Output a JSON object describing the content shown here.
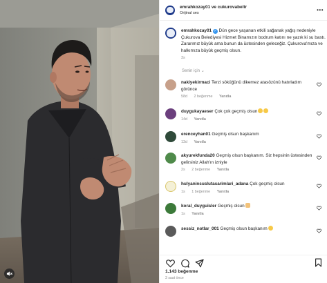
{
  "header": {
    "title": "emrahkozay01 ve cukurovabeltr",
    "subtitle": "Orijinal ses",
    "more_icon": "more-horizontal-icon"
  },
  "caption": {
    "username": "emrahkozay01",
    "text": "Dün gece yaşanan etkili sağanak yağış nedeniyle Çukurova Belediyesi Hizmet Binamızın bodrum katını ne yazık ki su bastı. Zararımız büyük ama bunun da üstesinden geleceğiz. Çukurova'mıza ve halkımıza büyük geçmiş olsun.",
    "time": "3s"
  },
  "translate_label": "Senin için",
  "comments": [
    {
      "username": "nakiyekirmaci",
      "text": "Terzi söküğünü dikemez atasözünü hatırladım görünce",
      "time": "58d",
      "likes": "2 beğenme",
      "reply": "Yanıtla"
    },
    {
      "username": "duygukayaeser",
      "text": "Çok çok geçmiş olsun",
      "time": "14d",
      "likes": "",
      "reply": "Yanıtla"
    },
    {
      "username": "erenceyhan01",
      "text": "Geçmiş olsun başkanım",
      "time": "13d",
      "likes": "",
      "reply": "Yanıtla"
    },
    {
      "username": "akyurekfunda20",
      "text": "Geçmiş olsun başkanım. Siz hepsinin üstesinden gelirsiniz Allah'ın izniyle",
      "time": "2s",
      "likes": "2 beğenme",
      "reply": "Yanıtla"
    },
    {
      "username": "hulyaninsuslutasarimlari_adana",
      "text": "Çok geçmiş olsun",
      "time": "1s",
      "likes": "1 beğenme",
      "reply": "Yanıtla"
    },
    {
      "username": "koral_duyguisler",
      "text": "Geçmiş olsun",
      "time": "1s",
      "likes": "",
      "reply": "Yanıtla"
    },
    {
      "username": "sessiz_notlar_001",
      "text": "Geçmiş olsun başkanım",
      "time": "",
      "likes": "",
      "reply": ""
    }
  ],
  "actions": {
    "likes": "1.143 beğenme",
    "time_ago": "3 saat önce",
    "icons": [
      "heart-icon",
      "comment-icon",
      "share-icon",
      "bookmark-icon"
    ]
  },
  "colors": {
    "verified": "#3897f0",
    "muted_text": "#8e8e8e",
    "text": "#262626"
  }
}
